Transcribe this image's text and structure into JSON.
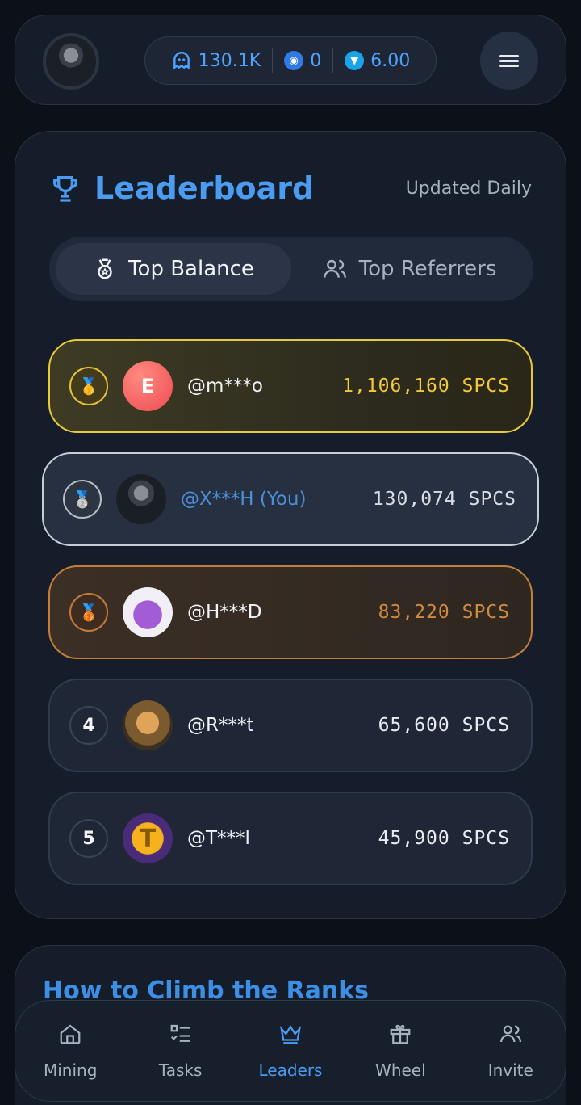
{
  "header": {
    "stats": [
      {
        "icon": "ghost-icon",
        "value": "130.1K"
      },
      {
        "icon": "blue-coin-icon",
        "value": "0"
      },
      {
        "icon": "ton-icon",
        "value": "6.00"
      }
    ]
  },
  "leaderboard": {
    "title": "Leaderboard",
    "updated": "Updated Daily",
    "tabs": [
      {
        "label": "Top Balance",
        "icon": "medal-icon",
        "active": true
      },
      {
        "label": "Top Referrers",
        "icon": "users-icon",
        "active": false
      }
    ],
    "entries": [
      {
        "rank": "1",
        "avatar_letter": "E",
        "name": "@m***o",
        "score": "1,106,160",
        "unit": "SPCS",
        "tier": "gold",
        "score_color": "#f2c93b"
      },
      {
        "rank": "2",
        "avatar_letter": "",
        "name": "@X***H (You)",
        "score": "130,074",
        "unit": "SPCS",
        "tier": "silver",
        "score_color": "#d9dde3",
        "name_color": "#4a8fd8"
      },
      {
        "rank": "3",
        "avatar_letter": "",
        "name": "@H***D",
        "score": "83,220",
        "unit": "SPCS",
        "tier": "bronze",
        "score_color": "#d38a3f"
      },
      {
        "rank": "4",
        "avatar_letter": "",
        "name": "@R***t",
        "score": "65,600",
        "unit": "SPCS",
        "tier": "plain",
        "score_color": "#e8ecf2"
      },
      {
        "rank": "5",
        "avatar_letter": "T",
        "name": "@T***l",
        "score": "45,900",
        "unit": "SPCS",
        "tier": "plain",
        "score_color": "#e8ecf2"
      }
    ]
  },
  "howto": {
    "title": "How to Climb the Ranks"
  },
  "nav": [
    {
      "label": "Mining",
      "icon": "home-icon",
      "active": false
    },
    {
      "label": "Tasks",
      "icon": "tasks-icon",
      "active": false
    },
    {
      "label": "Leaders",
      "icon": "crown-icon",
      "active": true
    },
    {
      "label": "Wheel",
      "icon": "gift-icon",
      "active": false
    },
    {
      "label": "Invite",
      "icon": "users-icon",
      "active": false
    }
  ],
  "colors": {
    "accent": "#4b9cf0",
    "gold": "#e7c93a",
    "silver": "#c7cdd6",
    "bronze": "#c57d3a"
  }
}
